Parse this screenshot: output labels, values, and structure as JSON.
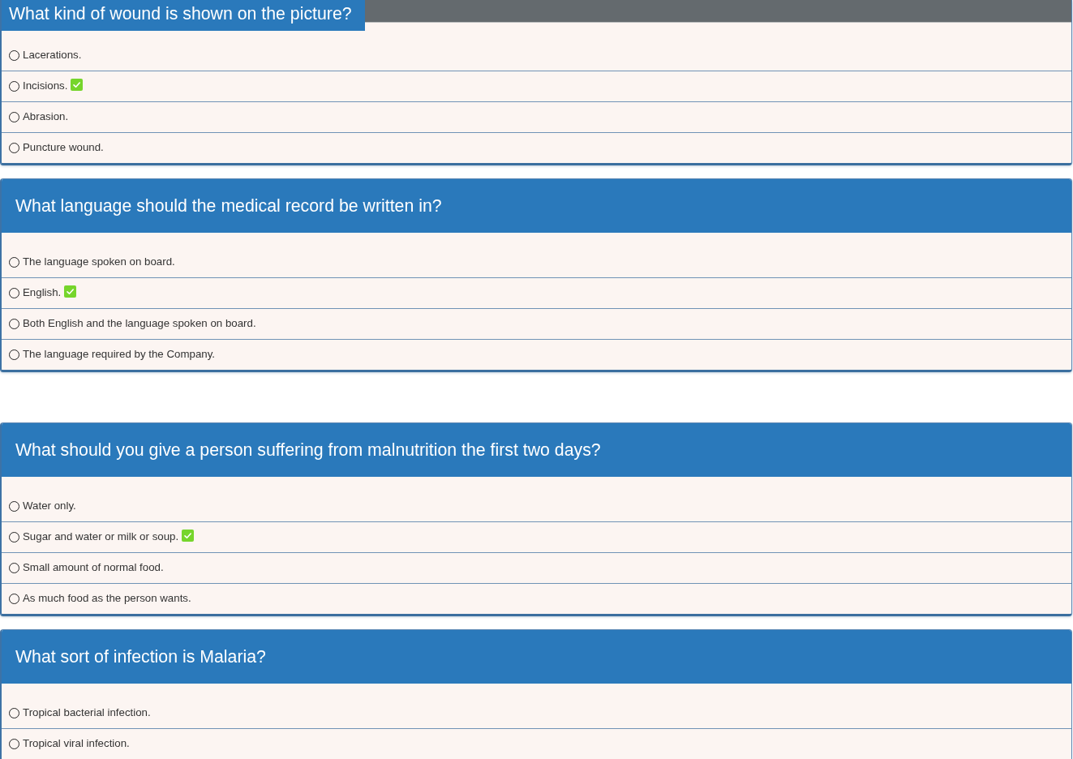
{
  "questions": [
    {
      "kind": "tab",
      "title": "What kind of wound is shown on the picture?",
      "answers": [
        {
          "text": "Lacerations.",
          "selected": false,
          "correct": false
        },
        {
          "text": "Incisions.",
          "selected": false,
          "correct": true
        },
        {
          "text": "Abrasion.",
          "selected": false,
          "correct": false
        },
        {
          "text": "Puncture wound.",
          "selected": false,
          "correct": false
        }
      ]
    },
    {
      "kind": "banner",
      "title": "What language should the medical record be written in?",
      "answers": [
        {
          "text": "The language spoken on board.",
          "selected": false,
          "correct": false
        },
        {
          "text": "English.",
          "selected": false,
          "correct": true
        },
        {
          "text": "Both English and the language spoken on board.",
          "selected": false,
          "correct": false
        },
        {
          "text": "The language required by the Company.",
          "selected": false,
          "correct": false
        }
      ]
    },
    {
      "kind": "banner",
      "title": "What should you give a person suffering from malnutrition the first two days?",
      "answers": [
        {
          "text": "Water only.",
          "selected": false,
          "correct": false
        },
        {
          "text": "Sugar and water or milk or soup.",
          "selected": false,
          "correct": true
        },
        {
          "text": "Small amount of normal food.",
          "selected": false,
          "correct": false
        },
        {
          "text": "As much food as the person wants.",
          "selected": false,
          "correct": false
        }
      ]
    },
    {
      "kind": "banner",
      "title": "What sort of infection is Malaria?",
      "answers": [
        {
          "text": "Tropical bacterial infection.",
          "selected": false,
          "correct": false
        },
        {
          "text": "Tropical viral infection.",
          "selected": false,
          "correct": false
        }
      ]
    }
  ]
}
